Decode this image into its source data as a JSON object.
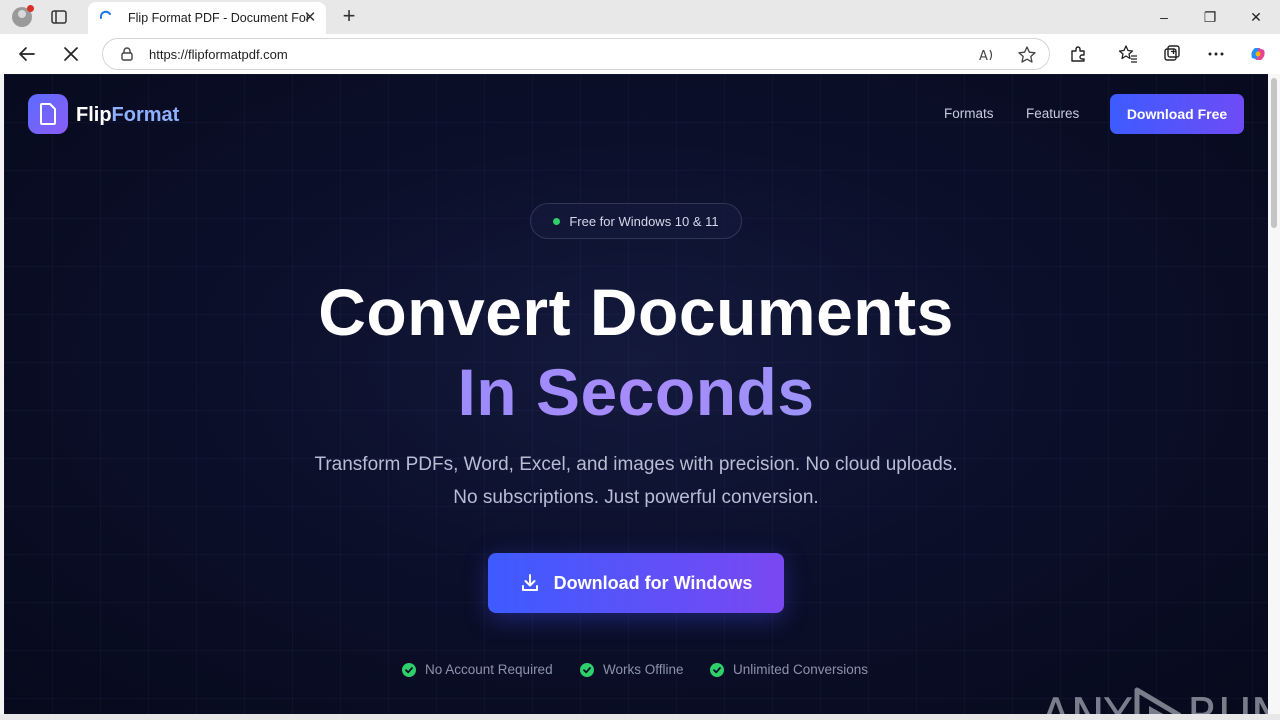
{
  "browser": {
    "tab_title": "Flip Format PDF - Document Form",
    "new_tab_label": "+",
    "url": "https://flipformatpdf.com",
    "window_controls": {
      "minimize": "–",
      "restore": "❐",
      "close": "✕"
    },
    "tab_close": "✕"
  },
  "site": {
    "logo": {
      "part1": "Flip",
      "part2": "Format"
    },
    "nav": {
      "formats": "Formats",
      "features": "Features",
      "cta": "Download Free"
    },
    "badge": "Free for Windows 10 & 11",
    "headline_line1": "Convert Documents",
    "headline_line2": "In Seconds",
    "subtitle_line1": "Transform PDFs, Word, Excel, and images with precision. No cloud uploads.",
    "subtitle_line2": "No subscriptions. Just powerful conversion.",
    "main_cta": "Download for Windows",
    "features": [
      "No Account Required",
      "Works Offline",
      "Unlimited Conversions"
    ]
  },
  "watermark": {
    "text_left": "ANY",
    "text_right": "RUN"
  },
  "colors": {
    "accent": "#3d5bff",
    "accent_purple": "#7a48f2",
    "background": "#0b0f2a",
    "check_green": "#2fd06a"
  }
}
